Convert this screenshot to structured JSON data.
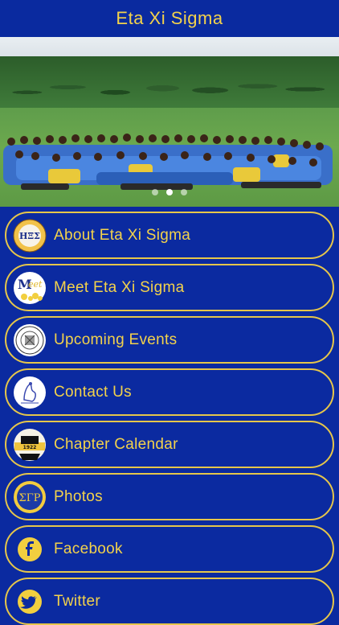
{
  "header": {
    "title": "Eta Xi Sigma"
  },
  "hero": {
    "slide_count": 3,
    "active_slide": 2
  },
  "menu": {
    "items": [
      {
        "label": "About Eta Xi Sigma",
        "icon": "sorority-crest-icon"
      },
      {
        "label": "Meet Eta Xi Sigma",
        "icon": "meet-logo-icon"
      },
      {
        "label": "Upcoming Events",
        "icon": "seal-icon"
      },
      {
        "label": "Contact Us",
        "icon": "poodle-icon"
      },
      {
        "label": "Chapter Calendar",
        "icon": "calendar-badge-icon"
      },
      {
        "label": "Photos",
        "icon": "sigma-gamma-rho-icon"
      },
      {
        "label": "Facebook",
        "icon": "facebook-icon"
      },
      {
        "label": "Twitter",
        "icon": "twitter-icon"
      }
    ]
  },
  "colors": {
    "background": "#0b2aa0",
    "accent": "#f3d24b",
    "border": "#e6c64a"
  }
}
